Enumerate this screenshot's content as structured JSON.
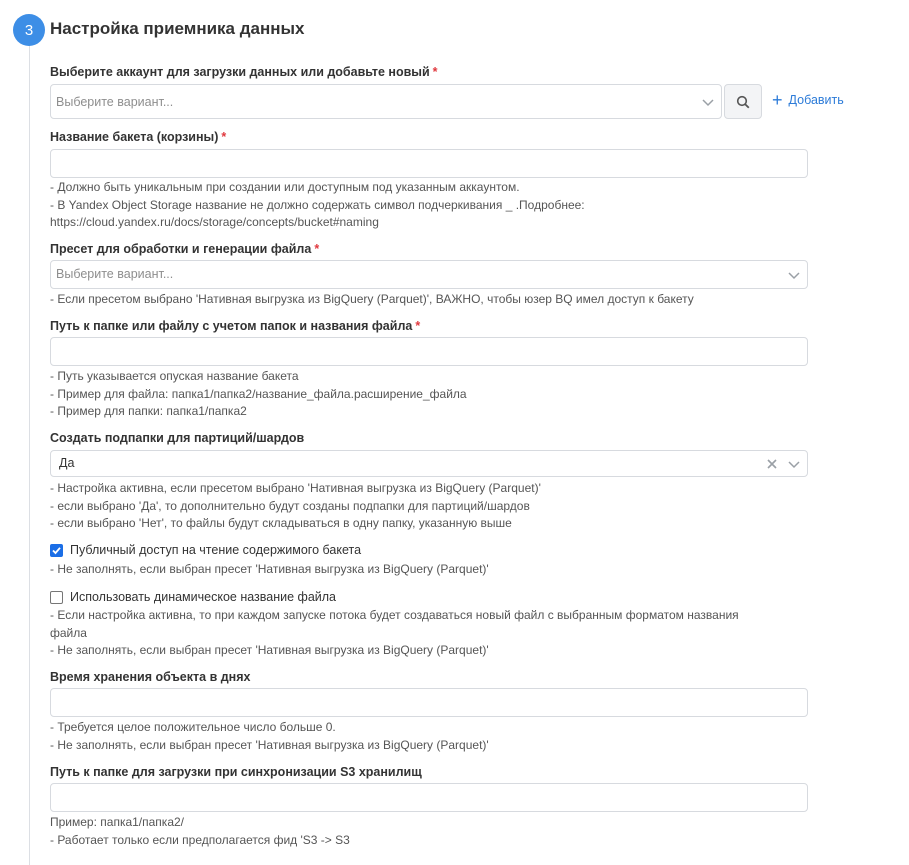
{
  "section": {
    "step_number": "3",
    "title": "Настройка приемника данных"
  },
  "colors": {
    "accent": "#3d8ee6",
    "link": "#2c7bd8",
    "required": "#e0383e",
    "checkbox_on": "#1b6ee6"
  },
  "account": {
    "label": "Выберите аккаунт для загрузки данных или добавьте новый",
    "required_mark": "*",
    "placeholder": "Выберите вариант...",
    "search_icon": "search-icon",
    "add_label": "Добавить"
  },
  "bucket": {
    "label": "Название бакета (корзины)",
    "required_mark": "*",
    "value": "",
    "hints": [
      "- Должно быть уникальным при создании или доступным под указанным аккаунтом.",
      "- В Yandex Object Storage название не должно содержать символ подчеркивания _ .Подробнее:",
      "https://cloud.yandex.ru/docs/storage/concepts/bucket#naming"
    ]
  },
  "preset": {
    "label": "Пресет для обработки и генерации файла",
    "required_mark": "*",
    "placeholder": "Выберите вариант...",
    "hints": [
      "- Если пресетом выбрано 'Нативная выгрузка из BigQuery (Parquet)', ВАЖНО, чтобы юзер BQ имел доступ к бакету"
    ]
  },
  "path": {
    "label": "Путь к папке или файлу с учетом папок и названия файла",
    "required_mark": "*",
    "value": "",
    "hints": [
      "- Путь указывается опуская название бакета",
      "- Пример для файла: папка1/папка2/название_файла.расширение_файла",
      "- Пример для папки: папка1/папка2"
    ]
  },
  "subfolders": {
    "label": "Создать подпапки для партиций/шардов",
    "value": "Да",
    "hints": [
      "- Настройка активна, если пресетом выбрано 'Нативная выгрузка из BigQuery (Parquet)'",
      "- если выбрано 'Да', то дополнительно будут созданы подпапки для партиций/шардов",
      "- если выбрано 'Нет', то файлы будут складываться в одну папку, указанную выше"
    ]
  },
  "public_access": {
    "label": "Публичный доступ на чтение содержимого бакета",
    "checked": true,
    "hints": [
      "- Не заполнять, если выбран пресет 'Нативная выгрузка из BigQuery (Parquet)'"
    ]
  },
  "dynamic_name": {
    "label": "Использовать динамическое название файла",
    "checked": false,
    "hints": [
      "- Если настройка активна, то при каждом запуске потока будет создаваться новый файл с выбранным форматом названия",
      "файла",
      "- Не заполнять, если выбран пресет 'Нативная выгрузка из BigQuery (Parquet)'"
    ]
  },
  "retention": {
    "label": "Время хранения объекта в днях",
    "value": "",
    "hints": [
      "- Требуется целое положительное число больше 0.",
      "- Не заполнять, если выбран пресет 'Нативная выгрузка из BigQuery (Parquet)'"
    ]
  },
  "sync_path": {
    "label": "Путь к папке для загрузки при синхронизации S3 хранилищ",
    "value": "",
    "hints": [
      "Пример: папка1/папка2/",
      "- Работает только если предполагается фид 'S3 -> S3"
    ]
  }
}
